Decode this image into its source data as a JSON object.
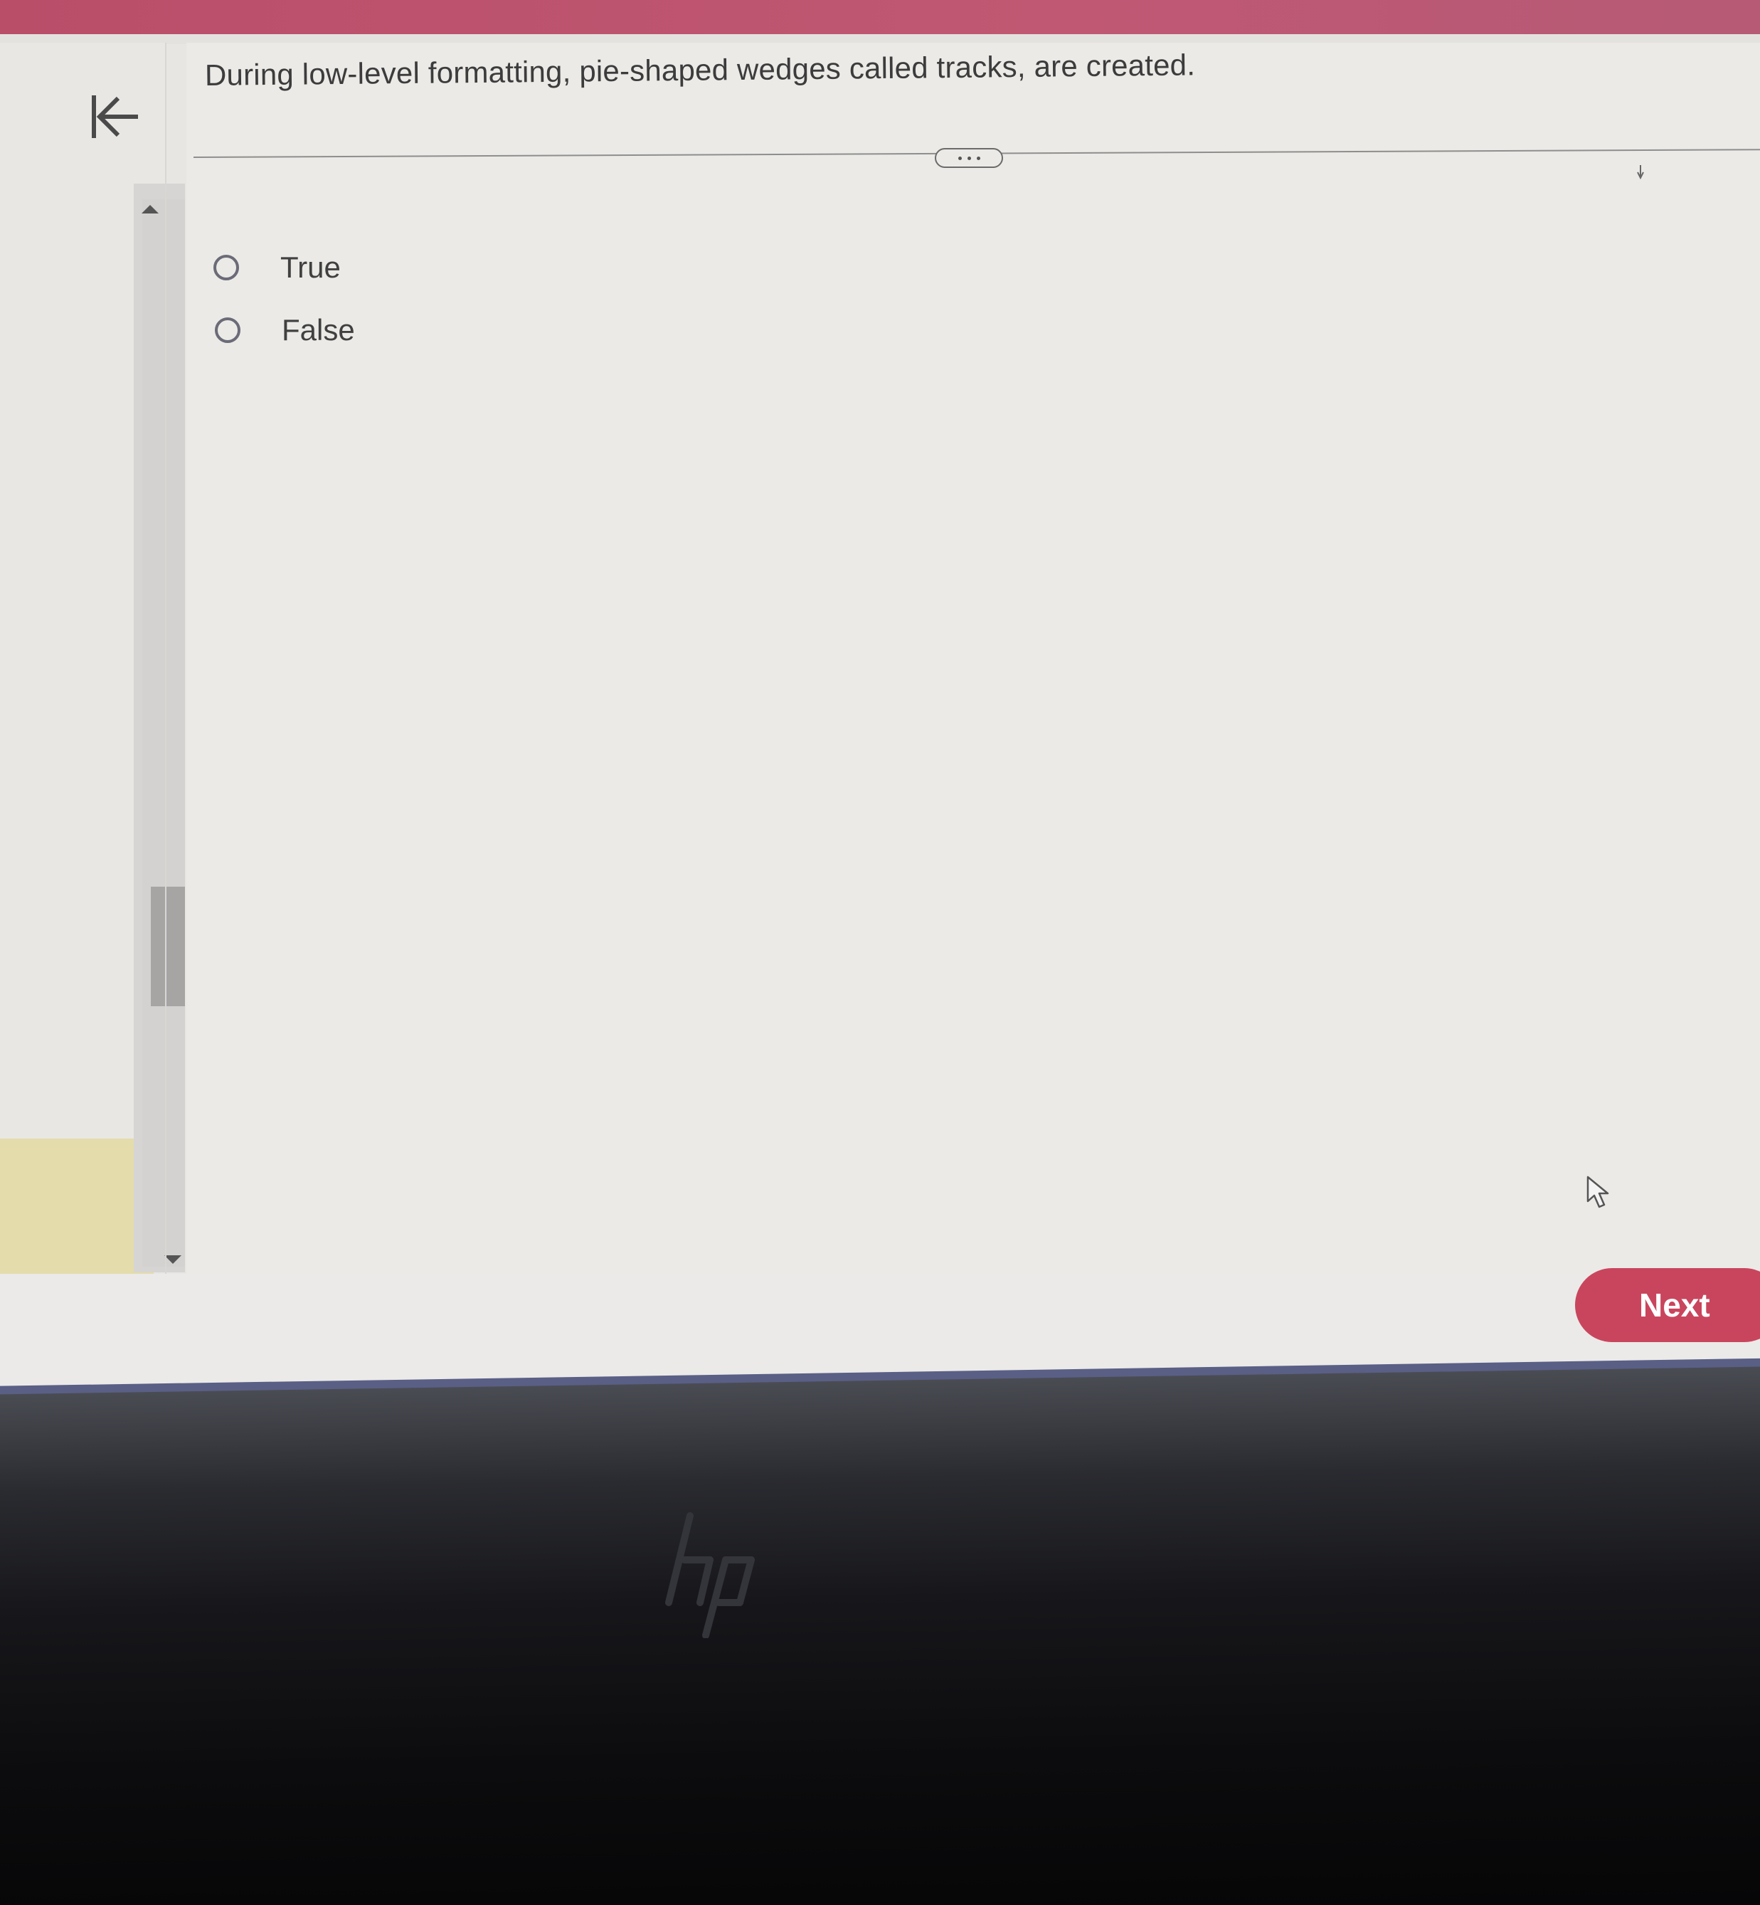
{
  "question": {
    "text": "During low-level formatting, pie-shaped wedges called tracks, are created."
  },
  "options": [
    {
      "label": "True",
      "selected": false
    },
    {
      "label": "False",
      "selected": false
    }
  ],
  "navigation": {
    "back_icon": "collapse-left-icon",
    "next_label": "Next"
  },
  "icons": {
    "more": "more-dots-icon",
    "scroll_up": "triangle-up-icon",
    "scroll_down": "triangle-down-icon",
    "cursor": "mouse-pointer-icon",
    "brand": "hp-logo"
  },
  "colors": {
    "top_bar": "#b94e69",
    "accent": "#c9455d",
    "highlight": "#e4dcab",
    "page_bg": "#ebeae7"
  }
}
